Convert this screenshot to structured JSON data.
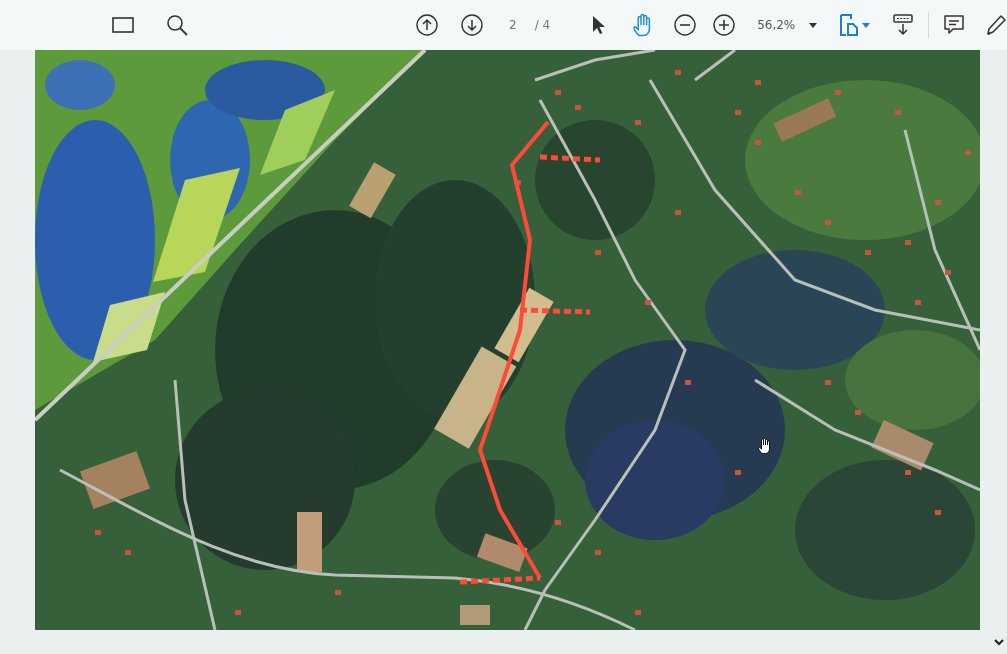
{
  "toolbar": {
    "page_number": "2",
    "page_count": "/ 4",
    "tools": [
      {
        "kind": "select",
        "selected": false
      },
      {
        "kind": "hand",
        "selected": true
      }
    ],
    "zoom_level": "56,2%",
    "page_layout": {
      "on": true
    }
  }
}
